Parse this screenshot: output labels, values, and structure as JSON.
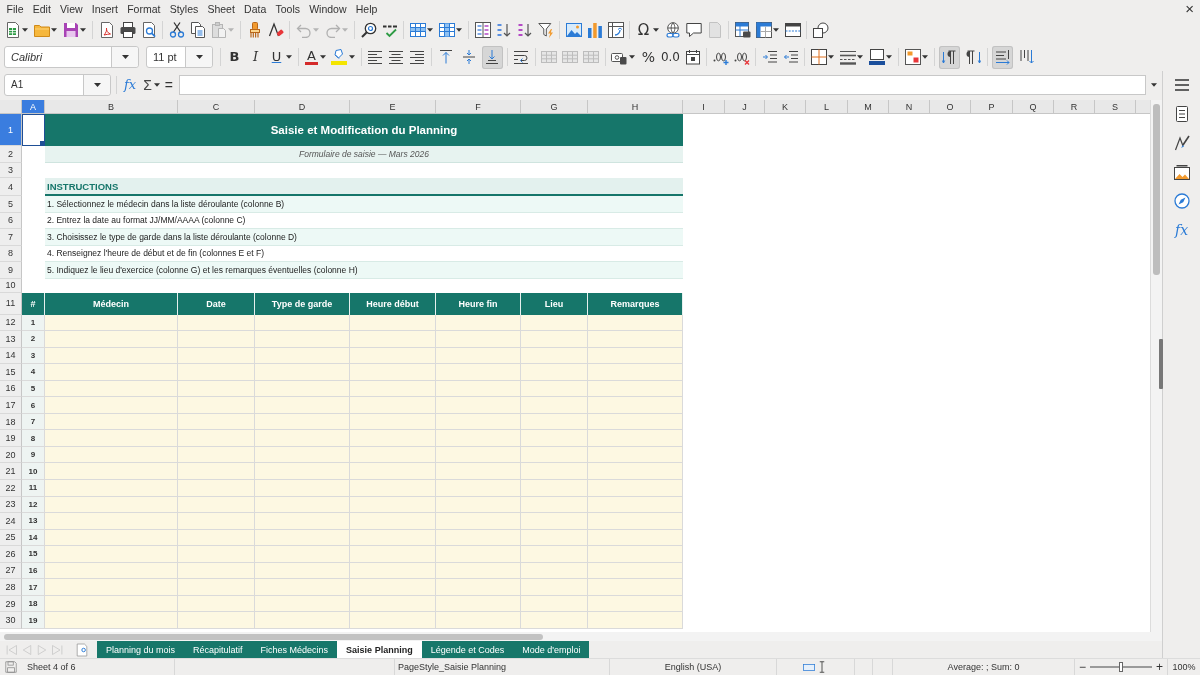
{
  "menu_bar": {
    "items": [
      "File",
      "Edit",
      "View",
      "Insert",
      "Format",
      "Styles",
      "Sheet",
      "Data",
      "Tools",
      "Window",
      "Help"
    ],
    "close": "×"
  },
  "standard_toolbar": {
    "special_character": "Ω"
  },
  "formatting_toolbar": {
    "font_name": "Calibri",
    "font_size": "11 pt",
    "bold": "B",
    "italic": "I",
    "underline": "U",
    "font_color": "A",
    "percent": "%",
    "number": "0.0",
    "vertical_align": [
      {
        "selected": false
      },
      {
        "selected": false
      },
      {
        "selected": true
      }
    ],
    "paragraph_direction": [
      {
        "selected": true
      },
      {
        "selected": false
      }
    ],
    "text_direction": [
      {
        "selected": true
      },
      {
        "selected": false
      }
    ]
  },
  "formula_bar": {
    "name_box": "A1",
    "function_wizard": "fx",
    "sum": "Σ",
    "equals": "="
  },
  "sidebar": {
    "functions": "fx"
  },
  "sheet": {
    "columns": [
      {
        "label": "A",
        "selected": true
      },
      {
        "label": "B",
        "selected": false
      },
      {
        "label": "C",
        "selected": false
      },
      {
        "label": "D",
        "selected": false
      },
      {
        "label": "E",
        "selected": false
      },
      {
        "label": "F",
        "selected": false
      },
      {
        "label": "G",
        "selected": false
      },
      {
        "label": "H",
        "selected": false
      },
      {
        "label": "I",
        "selected": false
      },
      {
        "label": "J",
        "selected": false
      },
      {
        "label": "K",
        "selected": false
      },
      {
        "label": "L",
        "selected": false
      },
      {
        "label": "M",
        "selected": false
      },
      {
        "label": "N",
        "selected": false
      },
      {
        "label": "O",
        "selected": false
      },
      {
        "label": "P",
        "selected": false
      },
      {
        "label": "Q",
        "selected": false
      },
      {
        "label": "R",
        "selected": false
      },
      {
        "label": "S",
        "selected": false
      }
    ],
    "rows": [
      {
        "label": "1",
        "selected": true
      },
      {
        "label": "2",
        "selected": false
      },
      {
        "label": "3",
        "selected": false
      },
      {
        "label": "4",
        "selected": false
      },
      {
        "label": "5",
        "selected": false
      },
      {
        "label": "6",
        "selected": false
      },
      {
        "label": "7",
        "selected": false
      },
      {
        "label": "8",
        "selected": false
      },
      {
        "label": "9",
        "selected": false
      },
      {
        "label": "10",
        "selected": false
      },
      {
        "label": "11",
        "selected": false
      },
      {
        "label": "12",
        "selected": false
      },
      {
        "label": "13",
        "selected": false
      },
      {
        "label": "14",
        "selected": false
      },
      {
        "label": "15",
        "selected": false
      },
      {
        "label": "16",
        "selected": false
      },
      {
        "label": "17",
        "selected": false
      },
      {
        "label": "18",
        "selected": false
      },
      {
        "label": "19",
        "selected": false
      },
      {
        "label": "20",
        "selected": false
      },
      {
        "label": "21",
        "selected": false
      },
      {
        "label": "22",
        "selected": false
      },
      {
        "label": "23",
        "selected": false
      },
      {
        "label": "24",
        "selected": false
      },
      {
        "label": "25",
        "selected": false
      },
      {
        "label": "26",
        "selected": false
      },
      {
        "label": "27",
        "selected": false
      },
      {
        "label": "28",
        "selected": false
      },
      {
        "label": "29",
        "selected": false
      },
      {
        "label": "30",
        "selected": false
      }
    ],
    "title": "Saisie et Modification du Planning",
    "subtitle": "Formulaire de saisie — Mars 2026",
    "instructions_heading": "INSTRUCTIONS",
    "instructions": [
      "1. Sélectionnez le médecin dans la liste déroulante (colonne B)",
      "2. Entrez la date au format JJ/MM/AAAA (colonne C)",
      "3. Choisissez le type de garde dans la liste déroulante (colonne D)",
      "4. Renseignez l'heure de début et de fin (colonnes E et F)",
      "5. Indiquez le lieu d'exercice (colonne G) et les remarques éventuelles (colonne H)"
    ],
    "table": {
      "columns": [
        "#",
        "Médecin",
        "Date",
        "Type de garde",
        "Heure début",
        "Heure fin",
        "Lieu",
        "Remarques"
      ],
      "rows": [
        {
          "number": "1"
        },
        {
          "number": "2"
        },
        {
          "number": "3"
        },
        {
          "number": "4"
        },
        {
          "number": "5"
        },
        {
          "number": "6"
        },
        {
          "number": "7"
        },
        {
          "number": "8"
        },
        {
          "number": "9"
        },
        {
          "number": "10"
        },
        {
          "number": "11"
        },
        {
          "number": "12"
        },
        {
          "number": "13"
        },
        {
          "number": "14"
        },
        {
          "number": "15"
        },
        {
          "number": "16"
        },
        {
          "number": "17"
        },
        {
          "number": "18"
        },
        {
          "number": "19"
        }
      ]
    }
  },
  "sheet_tabs": [
    {
      "label": "Planning du mois",
      "selected": false
    },
    {
      "label": "Récapitulatif",
      "selected": false
    },
    {
      "label": "Fiches Médecins",
      "selected": false
    },
    {
      "label": "Saisie Planning",
      "selected": true
    },
    {
      "label": "Légende et Codes",
      "selected": false
    },
    {
      "label": "Mode d'emploi",
      "selected": false
    }
  ],
  "status_bar": {
    "sheet": "Sheet 4 of 6",
    "page_style": "PageStyle_Saisie Planning",
    "language": "English (USA)",
    "selection_summary": "Average: ; Sum: 0",
    "zoom_out": "−",
    "zoom": {
      "level": 0.5
    },
    "zoom_in": "+",
    "zoom_percent": "100%"
  }
}
